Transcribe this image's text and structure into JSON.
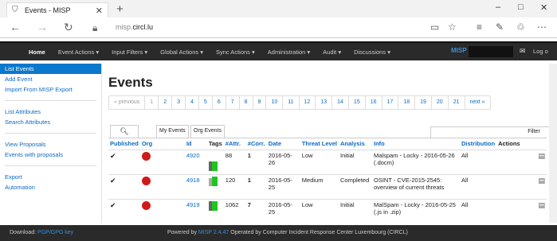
{
  "browser": {
    "tab_title": "Events - MISP",
    "url_prefix": "misp.",
    "url_domain": "circl.lu",
    "tab_icon": "shield-icon",
    "newtab": "+",
    "win_min": "–",
    "win_max": "□",
    "win_close": "✕"
  },
  "nav": {
    "home": "Home",
    "items": [
      "Event Actions ▾",
      "Input Filters ▾",
      "Global Actions ▾",
      "Sync Actions ▾",
      "Administration ▾",
      "Audit ▾",
      "Discussions ▾"
    ],
    "brand": "MISP",
    "logout": "Log o"
  },
  "sidebar": {
    "group1": [
      "List Events",
      "Add Event",
      "Import From MISP Export"
    ],
    "group2": [
      "List Attributes",
      "Search Attributes"
    ],
    "group3": [
      "View Proposals",
      "Events with proposals"
    ],
    "group4": [
      "Export",
      "Automation"
    ]
  },
  "main": {
    "title": "Events",
    "pager": [
      "« previous",
      "1",
      "2",
      "3",
      "4",
      "5",
      "6",
      "7",
      "8",
      "9",
      "10",
      "11",
      "12",
      "13",
      "14",
      "15",
      "16",
      "17",
      "18",
      "19",
      "20",
      "21",
      "next »"
    ],
    "filter_tabs": [
      "My Events",
      "Org Events"
    ],
    "filter_label": "Filter",
    "columns": [
      "Published",
      "Org",
      "Id",
      "Tags",
      "#Attr.",
      "#Corr.",
      "Date",
      "Threat Level",
      "Analysis",
      "Info",
      "Distribution",
      "Actions"
    ],
    "rows": [
      {
        "published": "✔",
        "id": "4920",
        "attr": "88",
        "corr": "1",
        "date": "2016-05-26",
        "threat": "Low",
        "analysis": "Initial",
        "info": "Malspam - Locky - 2016-05-26 (.docm)",
        "dist": "All"
      },
      {
        "published": "✔",
        "id": "4918",
        "attr": "120",
        "corr": "1",
        "date": "2016-05-25",
        "threat": "Medium",
        "analysis": "Completed",
        "info": "OSINT - CVE-2015-2545: overview of current threats",
        "dist": "All"
      },
      {
        "published": "✔",
        "id": "4919",
        "attr": "1062",
        "corr": "7",
        "date": "2016-05-25",
        "threat": "Low",
        "analysis": "Initial",
        "info": "MalSpam - Locky - 2016-05-25 (.js in .zip)",
        "dist": "All"
      }
    ]
  },
  "footer": {
    "download_label": "Download:",
    "download_link": "PGP/GPG key",
    "powered_prefix": "Powered by",
    "powered_link": "MISP 2.4.47",
    "powered_suffix": "Operated by Computer Incident Response Center Luxembourg (CIRCL)"
  }
}
